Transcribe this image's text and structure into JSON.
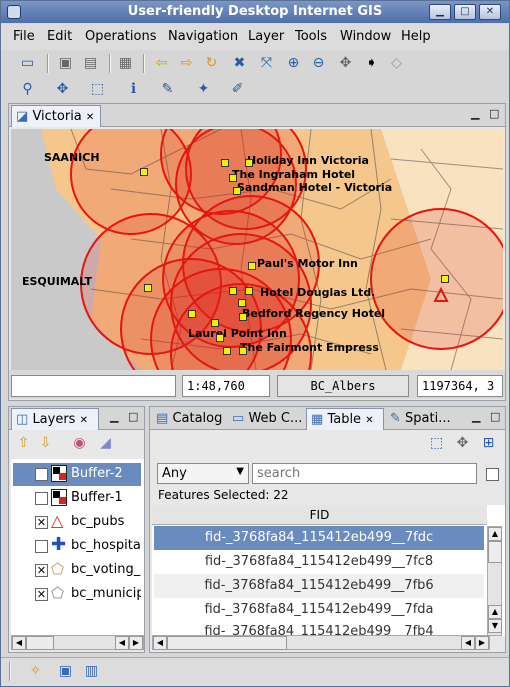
{
  "window": {
    "title": "User-friendly Desktop Internet GIS"
  },
  "menu": [
    "File",
    "Edit",
    "Operations",
    "Navigation",
    "Layer",
    "Tools",
    "Window",
    "Help"
  ],
  "map_panel": {
    "tab": "Victoria"
  },
  "map": {
    "area_labels": [
      "SAANICH",
      "ESQUIMALT"
    ],
    "hotels": [
      "Holiday Inn Victoria",
      "The Ingraham Hotel",
      "Sandman Hotel - Victoria",
      "Paul's Motor Inn",
      "Hotel Douglas Ltd.",
      "Bedford Regency Hotel",
      "Laurel Point Inn",
      "The Fairmont Empress"
    ]
  },
  "status": {
    "scale": "1:48,760",
    "crs": "BC_Albers",
    "coords": "1197364, 3"
  },
  "layers_panel": {
    "tab": "Layers",
    "items": [
      {
        "label": "Buffer-2",
        "checked": true
      },
      {
        "label": "Buffer-1",
        "checked": false
      },
      {
        "label": "bc_pubs",
        "checked": true
      },
      {
        "label": "bc_hospitals",
        "checked": false
      },
      {
        "label": "bc_voting_ar",
        "checked": true
      },
      {
        "label": "bc_municipa",
        "checked": true
      }
    ]
  },
  "bottom_tabs": [
    "Catalog",
    "Web C...",
    "Table",
    "Spati..."
  ],
  "table": {
    "filter": "Any",
    "search_placeholder": "search",
    "features_selected": "Features Selected: 22",
    "column": "FID",
    "rows": [
      "fid-_3768fa84_115412eb499__7fdc",
      "fid-_3768fa84_115412eb499__7fc8",
      "fid-_3768fa84_115412eb499__7fb6",
      "fid-_3768fa84_115412eb499__7fda",
      "fid-_3768fa84_115412eb499__7fb4"
    ]
  },
  "colors": {
    "title_bar": "#4f6fa8",
    "selected_row": "#6a8bbd",
    "buffer": "#e0201c",
    "map_fill": "#f5c78c"
  }
}
